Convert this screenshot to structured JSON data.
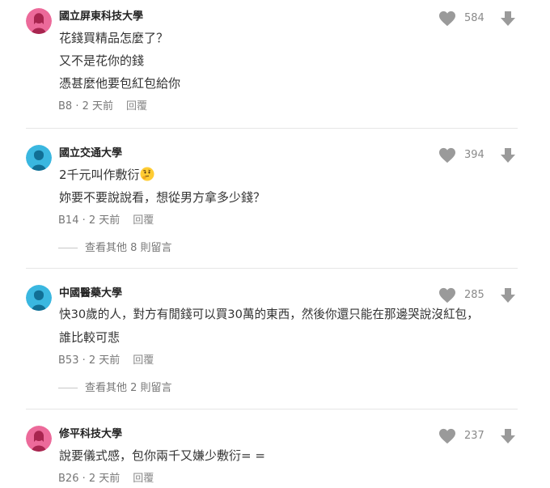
{
  "colors": {
    "avatar_female": "#ec6a9a",
    "avatar_male": "#3ab7e0",
    "icon": "#9a9a9a"
  },
  "comments": [
    {
      "school": "國立屏東科技大學",
      "avatar_icon": "female-avatar-icon",
      "lines": [
        "花錢買精品怎麼了？",
        "又不是花你的錢",
        "憑甚麼他要包紅包給你"
      ],
      "floor": "B8",
      "time": "2 天前",
      "reply": "回覆",
      "likes": "584"
    },
    {
      "school": "國立交通大學",
      "avatar_icon": "male-avatar-icon",
      "lines": [
        "2千元叫作敷衍",
        "妳要不要說說看，想從男方拿多少錢？"
      ],
      "emoji": "thinking-face-icon",
      "floor": "B14",
      "time": "2 天前",
      "reply": "回覆",
      "likes": "394",
      "more": "查看其他 8 則留言"
    },
    {
      "school": "中國醫藥大學",
      "avatar_icon": "male-avatar-icon",
      "lines": [
        "快30歲的人，對方有閒錢可以買30萬的東西，然後你還只能在那邊哭說沒紅包，",
        "誰比較可悲"
      ],
      "floor": "B53",
      "time": "2 天前",
      "reply": "回覆",
      "likes": "285",
      "more": "查看其他 2 則留言"
    },
    {
      "school": "修平科技大學",
      "avatar_icon": "female-avatar-icon",
      "lines": [
        "說要儀式感，包你兩千又嫌少敷衍= ="
      ],
      "floor": "B26",
      "time": "2 天前",
      "reply": "回覆",
      "likes": "237"
    }
  ]
}
